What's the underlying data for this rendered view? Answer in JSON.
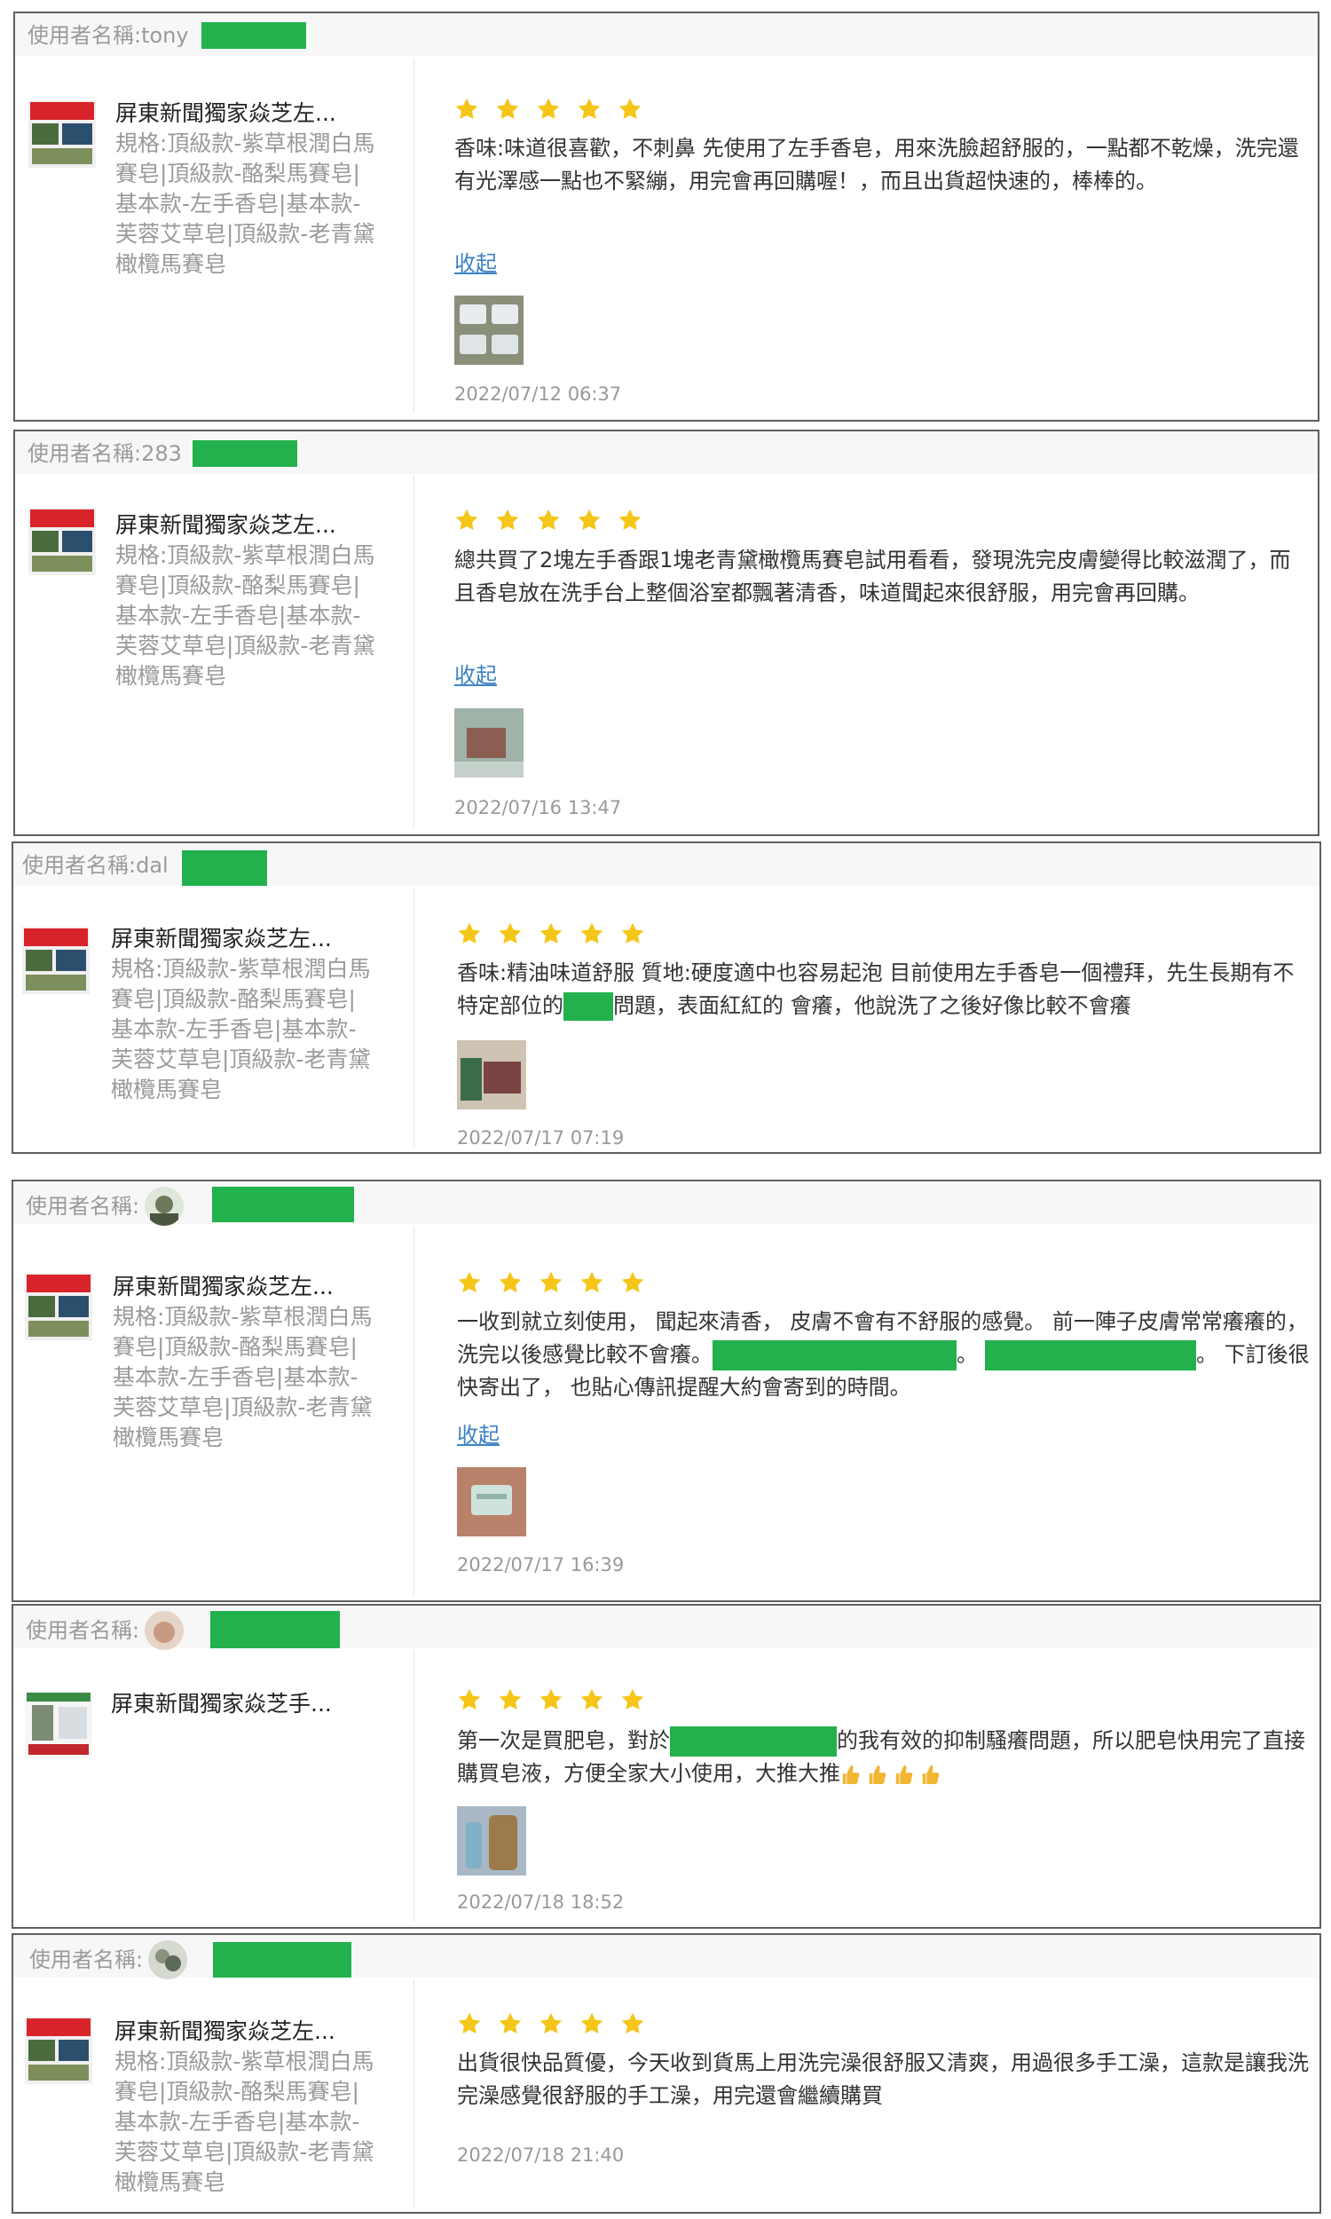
{
  "reviews": [
    {
      "user_label": "使用者名稱:tony",
      "product_title": "屏東新聞獨家焱芝左...",
      "spec": "規格:頂級款-紫草根潤白馬賽皂|頂級款-酪梨馬賽皂|基本款-左手香皂|基本款-芙蓉艾草皂|頂級款-老青黛橄欖馬賽皂",
      "rating": 5,
      "comment": "香味:味道很喜歡，不刺鼻 先使用了左手香皂，用來洗臉超舒服的，一點都不乾燥，洗完還有光澤感一點也不緊繃，用完會再回購喔！，而且出貨超快速的，棒棒的。",
      "collapse_label": "收起",
      "date": "2022/07/12 06:37"
    },
    {
      "user_label": "使用者名稱:283",
      "product_title": "屏東新聞獨家焱芝左...",
      "spec": "規格:頂級款-紫草根潤白馬賽皂|頂級款-酪梨馬賽皂|基本款-左手香皂|基本款-芙蓉艾草皂|頂級款-老青黛橄欖馬賽皂",
      "rating": 5,
      "comment": "總共買了2塊左手香跟1塊老青黛橄欖馬賽皂試用看看，發現洗完皮膚變得比較滋潤了，而且香皂放在洗手台上整個浴室都飄著清香，味道聞起來很舒服，用完會再回購。",
      "collapse_label": "收起",
      "date": "2022/07/16 13:47"
    },
    {
      "user_label": "使用者名稱:dal",
      "product_title": "屏東新聞獨家焱芝左...",
      "spec": "規格:頂級款-紫草根潤白馬賽皂|頂級款-酪梨馬賽皂|基本款-左手香皂|基本款-芙蓉艾草皂|頂級款-老青黛橄欖馬賽皂",
      "rating": 5,
      "comment_a": "香味:精油味道舒服 質地:硬度適中也容易起泡 目前使用左手香皂一個禮拜，先生長期有不特定部位的",
      "comment_b": "問題，表面紅紅的 會癢，他說洗了之後好像比較不會癢",
      "date": "2022/07/17 07:19"
    },
    {
      "user_label": "使用者名稱:",
      "product_title": "屏東新聞獨家焱芝左...",
      "spec": "規格:頂級款-紫草根潤白馬賽皂|頂級款-酪梨馬賽皂|基本款-左手香皂|基本款-芙蓉艾草皂|頂級款-老青黛橄欖馬賽皂",
      "rating": 5,
      "comment_a": "一收到就立刻使用， 聞起來清香， 皮膚不會有不舒服的感覺。 前一陣子皮膚常常癢癢的， 洗完以後感覺比較不會癢。",
      "comment_b": "。",
      "comment_c": "。 下訂後很快寄出了， 也貼心傳訊提醒大約會寄到的時間。",
      "collapse_label": "收起",
      "date": "2022/07/17 16:39"
    },
    {
      "user_label": "使用者名稱:",
      "product_title": "屏東新聞獨家焱芝手...",
      "rating": 5,
      "comment_a": "第一次是買肥皂，對於",
      "comment_b": "的我有效的抑制騷癢問題，所以肥皂快用完了直接購買皂液，方便全家大小使用，大推大推",
      "emoji_name": "thumbs-up-icon",
      "date": "2022/07/18 18:52"
    },
    {
      "user_label": "使用者名稱:",
      "product_title": "屏東新聞獨家焱芝左...",
      "spec": "規格:頂級款-紫草根潤白馬賽皂|頂級款-酪梨馬賽皂|基本款-左手香皂|基本款-芙蓉艾草皂|頂級款-老青黛橄欖馬賽皂",
      "rating": 5,
      "comment": "出貨很快品質優，今天收到貨馬上用洗完澡很舒服又清爽，用過很多手工澡，這款是讓我洗完澡感覺很舒服的手工澡，用完還會繼續購買",
      "date": "2022/07/18 21:40"
    }
  ],
  "colors": {
    "star": "#f5c518",
    "redaction": "#23b14d",
    "link": "#3b82c4",
    "border": "#5f5f5f"
  }
}
